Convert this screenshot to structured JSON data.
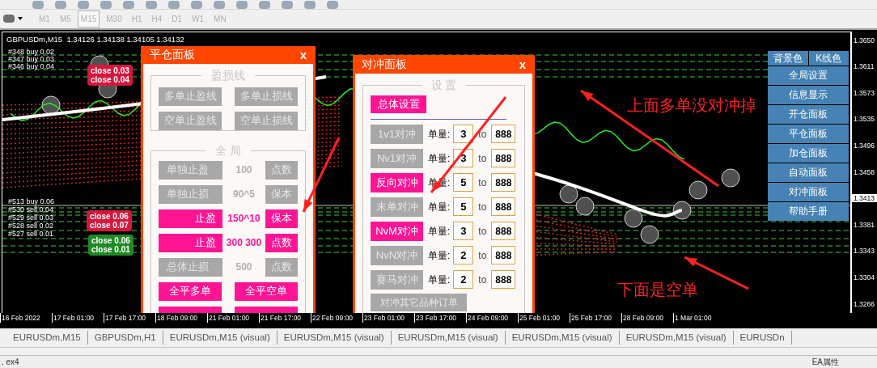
{
  "toolbar": {
    "timeframes": [
      {
        "label": "M1",
        "selected": false
      },
      {
        "label": "M5",
        "selected": false
      },
      {
        "label": "M15",
        "selected": true
      },
      {
        "label": "M30",
        "selected": false
      },
      {
        "label": "H1",
        "selected": false
      },
      {
        "label": "H4",
        "selected": false
      },
      {
        "label": "D1",
        "selected": false
      },
      {
        "label": "W1",
        "selected": false
      },
      {
        "label": "MN",
        "selected": false
      }
    ]
  },
  "chart": {
    "title": "GBPUSDm,M15  1.34126 1.34138 1.34105 1.34132",
    "order_labels_top": [
      "#348 buy 0.02",
      "#347 buy 0.03",
      "#346 buy 0.04"
    ],
    "order_labels_bottom": [
      "#513 buy 0.06",
      "#530 sell 0.04",
      "#529 sell 0.03",
      "#528 sell 0.02",
      "#527 sell 0.01"
    ],
    "close_tags": [
      {
        "color": "#d8163c",
        "lines": [
          "close 0.03",
          "close 0.04"
        ]
      },
      {
        "color": "#d8163c",
        "lines": [
          "close 0.06",
          "close 0.07"
        ]
      },
      {
        "color": "#1f8a25",
        "lines": [
          "close 0.06",
          "close 0.01"
        ]
      }
    ],
    "notes": [
      "上面多单没对冲掉",
      "下面是空单"
    ],
    "price_axis": [
      {
        "label": "1.3650",
        "current": false
      },
      {
        "label": "1.3611",
        "current": false
      },
      {
        "label": "1.3573",
        "current": false
      },
      {
        "label": "1.3535",
        "current": false
      },
      {
        "label": "1.3496",
        "current": false
      },
      {
        "label": "1.3458",
        "current": false
      },
      {
        "label": "1.3413",
        "current": true
      },
      {
        "label": "1.3381",
        "current": false
      },
      {
        "label": "1.3343",
        "current": false
      },
      {
        "label": "1.3304",
        "current": false
      },
      {
        "label": "1.3266",
        "current": false
      }
    ],
    "time_axis": [
      "16 Feb 2022",
      "17 Feb 01:00",
      "17 Feb 17:00",
      "18 Feb 09:00",
      "21 Feb 01:00",
      "21 Feb 17:00",
      "22 Feb 09:00",
      "23 Feb 01:00",
      "23 Feb 17:00",
      "24 Feb 09:00",
      "25 Feb 01:00",
      "25 Feb 17:00",
      "28 Feb 09:00",
      "1 Mar 01:00"
    ]
  },
  "close_panel": {
    "title": "平仓面板",
    "close": "x",
    "lines_section": {
      "legend": "盈损线",
      "buttons": [
        {
          "label": "多单止盈线",
          "active": false
        },
        {
          "label": "多单止损线",
          "active": false
        },
        {
          "label": "空单止盈线",
          "active": false
        },
        {
          "label": "空单止损线",
          "active": false
        }
      ]
    },
    "global_section": {
      "legend": "全 局",
      "rows": [
        {
          "label": "单独止盈",
          "value": "100",
          "action": "点数",
          "active": false
        },
        {
          "label": "单独止损",
          "value": "90^5",
          "action": "保本",
          "active": false
        },
        {
          "label": "止盈",
          "value": "150^10",
          "action": "保本",
          "active": true
        },
        {
          "label": "止盈",
          "value": "300 300",
          "action": "点数",
          "active": true
        },
        {
          "label": "总体止损",
          "value": "500",
          "action": "点数",
          "active": false
        }
      ],
      "buttons": [
        {
          "label": "全平多单",
          "active": true
        },
        {
          "label": "全平空单",
          "active": true
        }
      ]
    }
  },
  "hedge_panel": {
    "title": "对冲面板",
    "close": "x",
    "legend": "设 置",
    "overall": {
      "label": "总体设置",
      "active": true
    },
    "rows": [
      {
        "label": "1v1对冲",
        "selected": false,
        "qty_label": "单量:",
        "qty": "3",
        "to": "to",
        "max": "888"
      },
      {
        "label": "Nv1对冲",
        "selected": false,
        "qty_label": "单量:",
        "qty": "3",
        "to": "to",
        "max": "888"
      },
      {
        "label": "反向对冲",
        "selected": true,
        "qty_label": "单量:",
        "qty": "5",
        "to": "to",
        "max": "888"
      },
      {
        "label": "末单对冲",
        "selected": false,
        "qty_label": "单量:",
        "qty": "5",
        "to": "to",
        "max": "888"
      },
      {
        "label": "NvM对冲",
        "selected": true,
        "qty_label": "单量:",
        "qty": "3",
        "to": "to",
        "max": "888"
      },
      {
        "label": "NvN对冲",
        "selected": false,
        "qty_label": "单量:",
        "qty": "2",
        "to": "to",
        "max": "888"
      },
      {
        "label": "赛马对冲",
        "selected": false,
        "qty_label": "单量:",
        "qty": "2",
        "to": "to",
        "max": "888"
      }
    ],
    "other": {
      "label": "对冲其它品种订单",
      "active": false
    }
  },
  "side_menu": {
    "top": [
      "背景色",
      "K线色"
    ],
    "items": [
      "全局设置",
      "信息显示",
      "开仓面板",
      "平仓面板",
      "加仓面板",
      "自动面板",
      "对冲面板",
      "帮助手册"
    ]
  },
  "chart_tabs": [
    "EURUSDm,M15",
    "GBPUSDm,H1",
    "EURUSDm,M15 (visual)",
    "EURUSDm,M15 (visual)",
    "EURUSDm,M15 (visual)",
    "EURUSDm,M15 (visual)",
    "EURUSDm,M15 (visual)",
    "EURUSDn"
  ],
  "status": {
    "file": ". ex4",
    "properties": "EA属性"
  }
}
